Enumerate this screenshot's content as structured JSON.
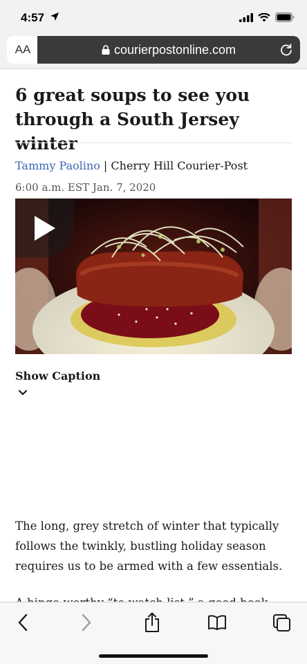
{
  "status_bar": {
    "time": "4:57",
    "icons": [
      "location-arrow-icon",
      "cellular-signal-icon",
      "wifi-icon",
      "battery-icon"
    ]
  },
  "browser": {
    "text_size_label": "AA",
    "url": "courierpostonline.com"
  },
  "article": {
    "headline": "6 great soups to see you through a South Jersey winter",
    "author": "Tammy Paolino",
    "byline_separator": " | ",
    "publication": "Cherry Hill Courier-Post",
    "dateline": "6:00 a.m. EST Jan. 7, 2020",
    "media": {
      "type": "video",
      "icon": "play-icon"
    },
    "show_caption_label": "Show Caption",
    "body": [
      "The long, grey stretch of winter that typically follows the twinkly, bustling holiday season requires us to be armed with a few essentials.",
      "A binge-worthy “to watch list,” a good book, fuzzy"
    ]
  },
  "toolbar": {
    "icons": [
      "back-arrow-icon",
      "forward-arrow-icon",
      "share-icon",
      "bookmarks-icon",
      "tabs-icon"
    ]
  }
}
